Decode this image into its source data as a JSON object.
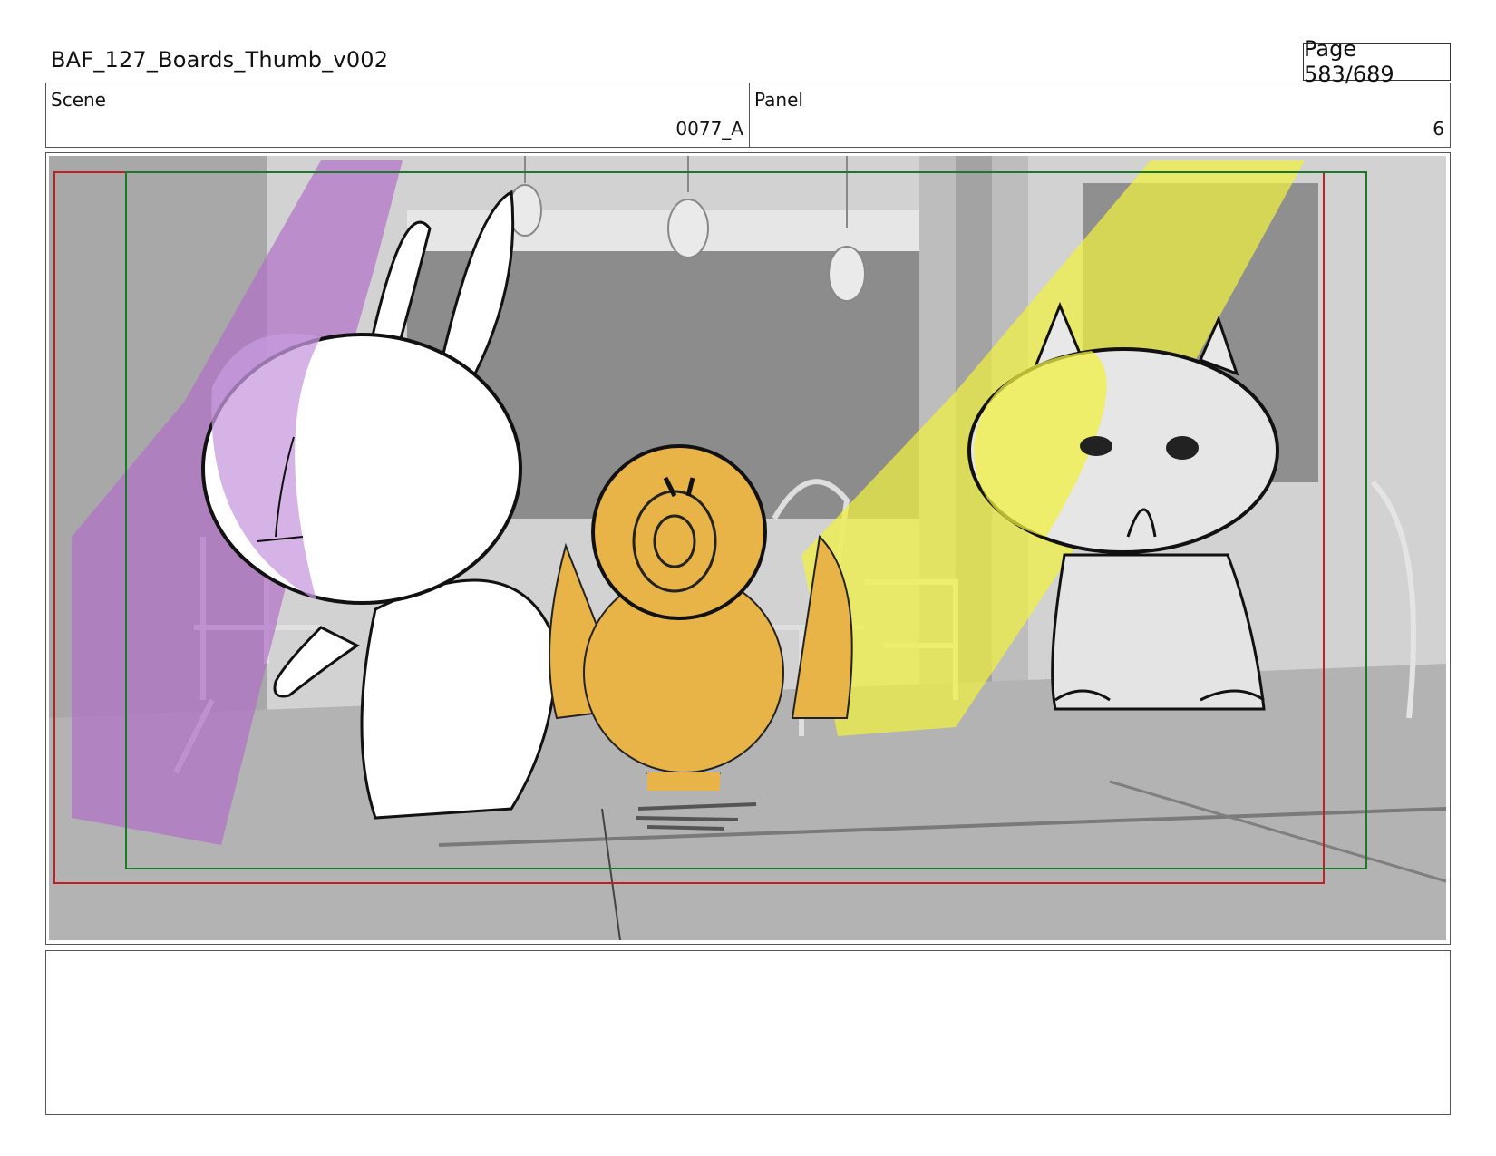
{
  "header": {
    "file_title": "BAF_127_Boards_Thumb_v002",
    "page_label": "Page 583/689"
  },
  "info": {
    "scene_label": "Scene",
    "scene_value": "0077_A",
    "panel_label": "Panel",
    "panel_value": "6"
  },
  "colors": {
    "purple_light": "#b070c8",
    "yellow_light": "#f0f040",
    "bird_orange": "#e8b448",
    "safe_red": "#c02020",
    "safe_green": "#1a7a2a"
  },
  "notes": {
    "text": ""
  }
}
